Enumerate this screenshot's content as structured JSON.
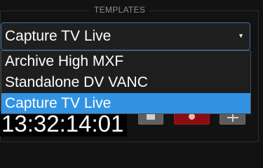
{
  "panel": {
    "title": "TEMPLATES"
  },
  "combo": {
    "selected": "Capture TV Live",
    "arrow_icon": "dropdown-caret-icon"
  },
  "dropdown": {
    "options": [
      "Archive High MXF",
      "Standalone DV VANC",
      "Capture TV Live"
    ],
    "selected_index": 2
  },
  "timecode": {
    "value": "13:32:14:01"
  },
  "buttons": {
    "stop_icon": "stop-icon",
    "record_icon": "record-icon",
    "split_icon": "split-icon"
  },
  "colors": {
    "accent": "#3393e3",
    "record": "#8b0d12",
    "background": "#121212"
  }
}
